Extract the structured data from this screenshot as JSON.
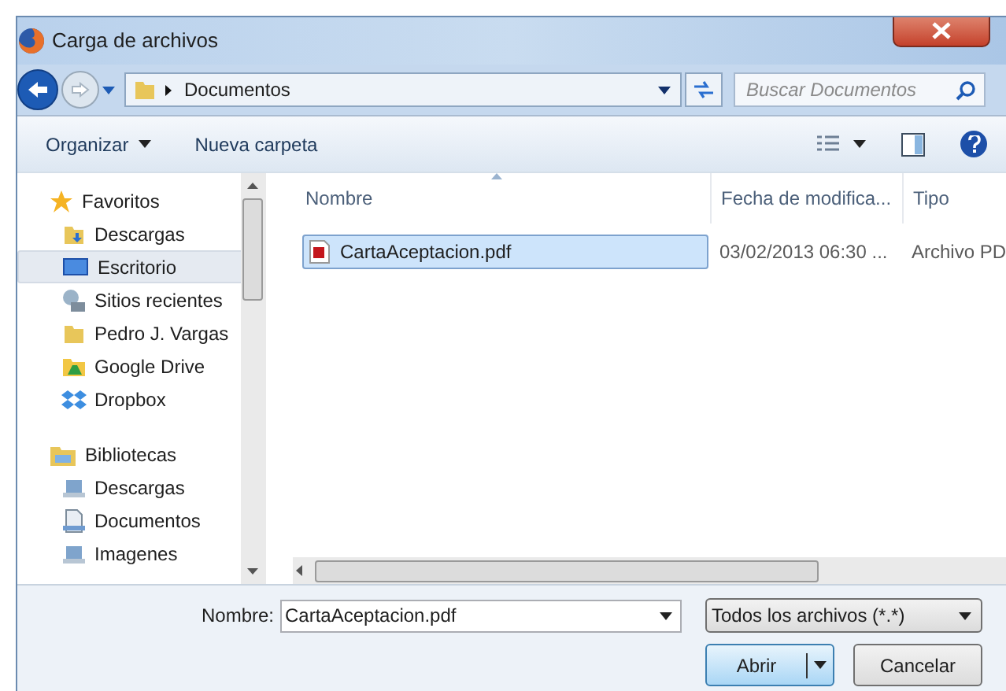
{
  "window": {
    "title": "Carga de archivos"
  },
  "address_bar": {
    "path": "Documentos"
  },
  "search": {
    "placeholder": "Buscar Documentos"
  },
  "toolbar": {
    "organize": "Organizar",
    "new_folder": "Nueva carpeta"
  },
  "sidebar": {
    "groups": [
      {
        "label": "Favoritos",
        "children": [
          {
            "label": "Descargas",
            "selected": false
          },
          {
            "label": "Escritorio",
            "selected": true
          },
          {
            "label": "Sitios recientes",
            "selected": false
          },
          {
            "label": "Pedro J. Vargas",
            "selected": false
          },
          {
            "label": "Google Drive",
            "selected": false
          },
          {
            "label": "Dropbox",
            "selected": false
          }
        ]
      },
      {
        "label": "Bibliotecas",
        "children": [
          {
            "label": "Descargas",
            "selected": false
          },
          {
            "label": "Documentos",
            "selected": false
          },
          {
            "label": "Imagenes",
            "selected": false
          }
        ]
      }
    ]
  },
  "table": {
    "columns": [
      "Nombre",
      "Fecha de modifica...",
      "Tipo"
    ],
    "rows": [
      {
        "cells": [
          "CartaAceptacion.pdf",
          "03/02/2013 06:30 ...",
          "Archivo PD"
        ],
        "selected": true
      }
    ]
  },
  "filename": {
    "label": "Nombre:",
    "value": "CartaAceptacion.pdf"
  },
  "filter": {
    "value": "Todos los archivos (*.*)"
  },
  "buttons": {
    "open": "Abrir",
    "cancel": "Cancelar"
  }
}
